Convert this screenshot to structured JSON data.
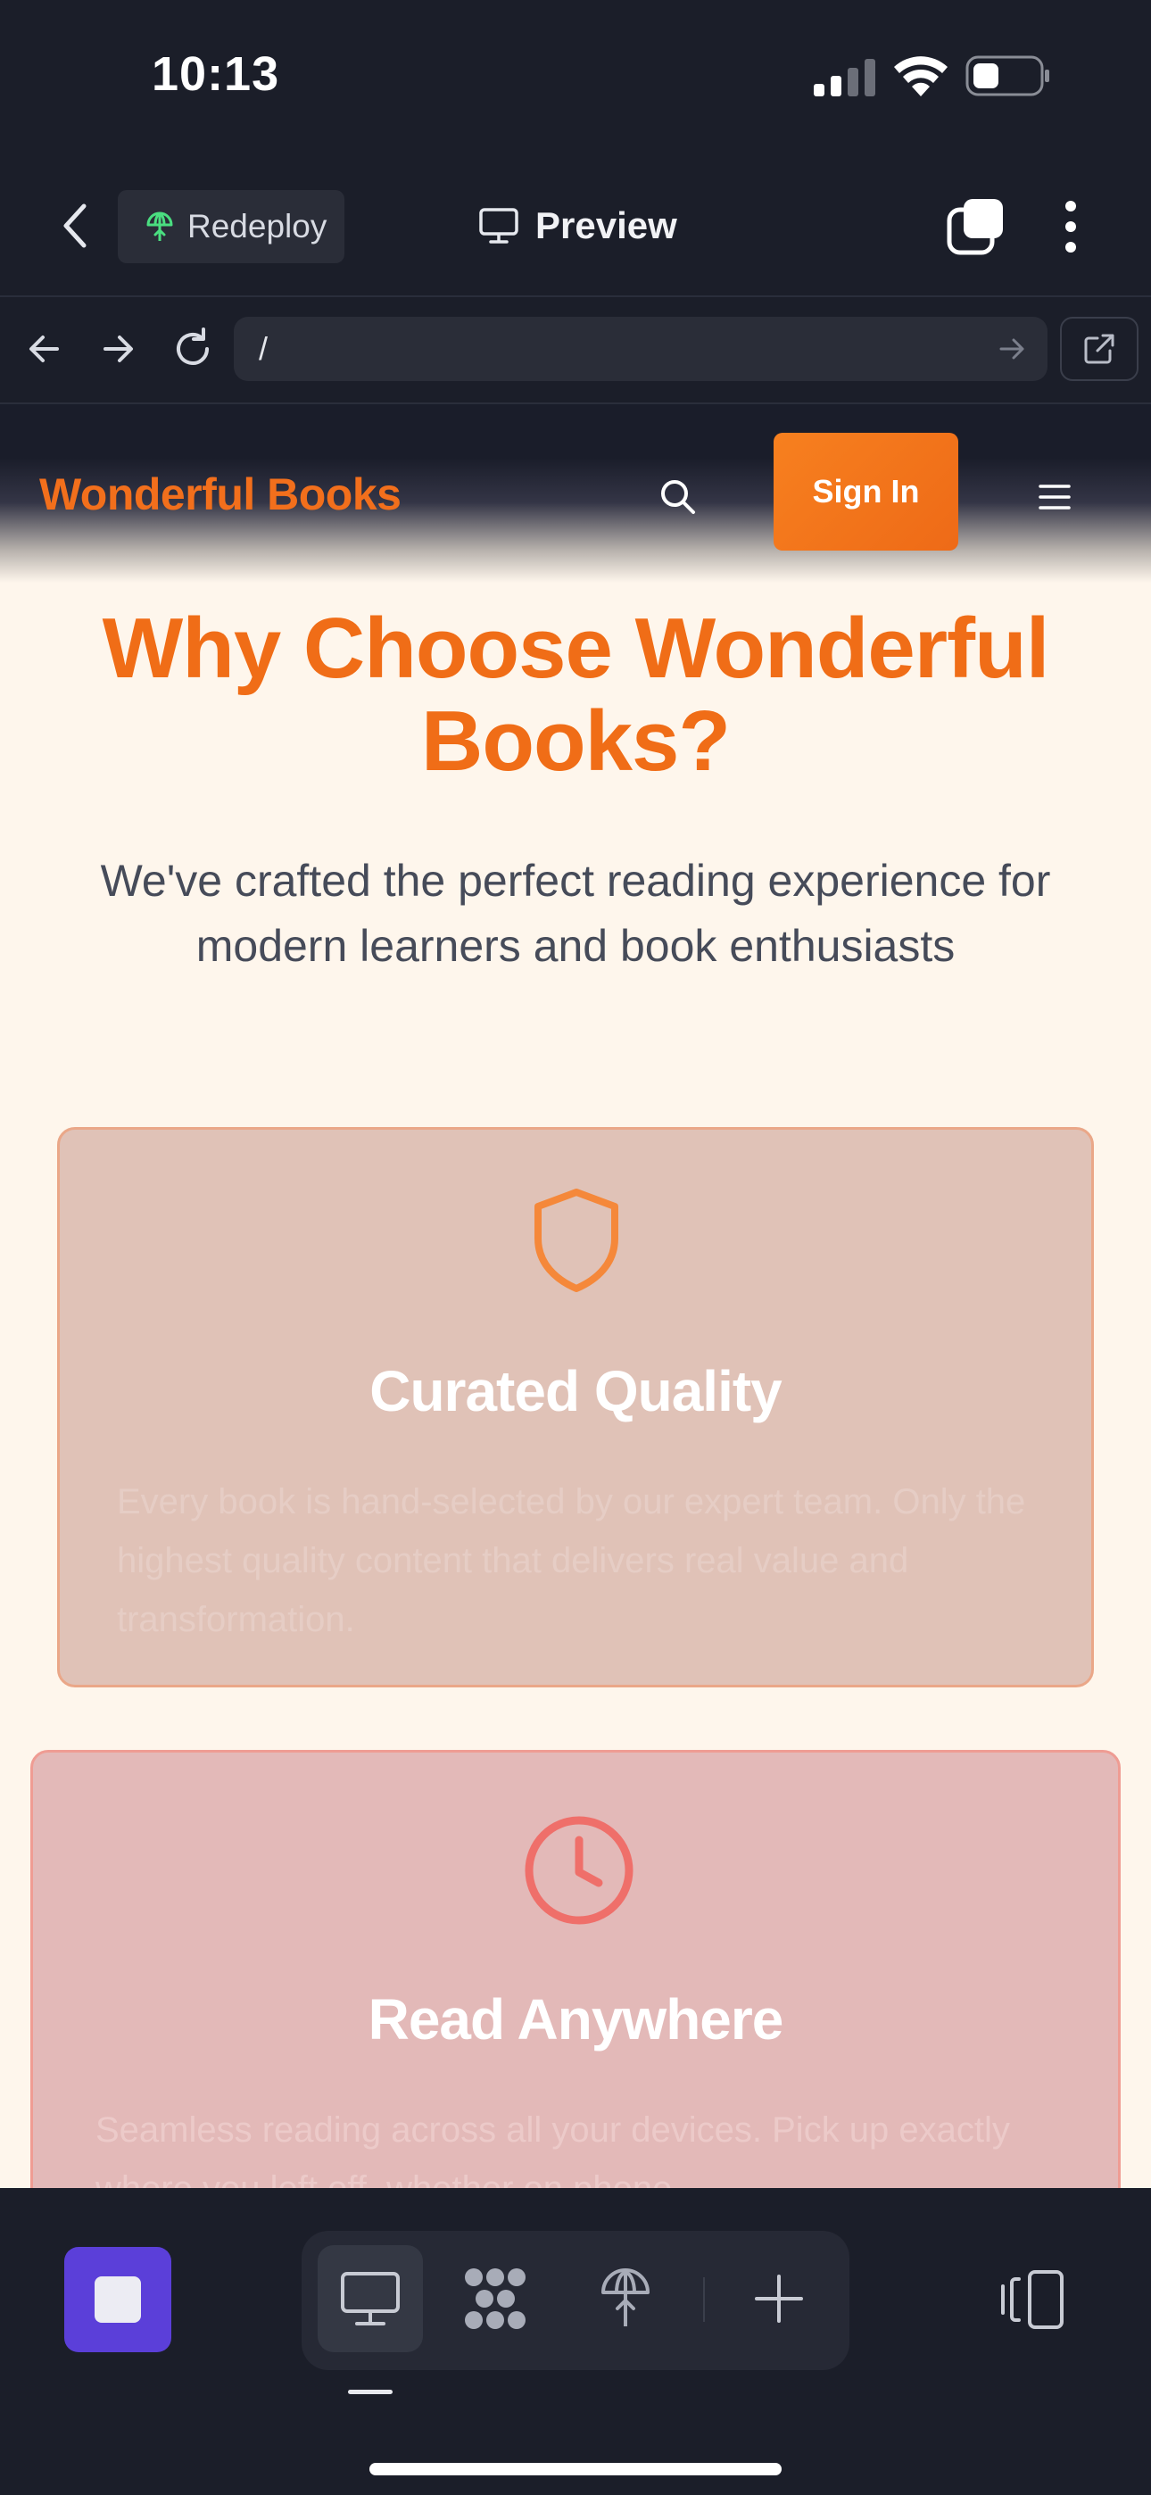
{
  "status_bar": {
    "time": "10:13"
  },
  "header": {
    "redeploy_label": "Redeploy",
    "preview_label": "Preview"
  },
  "browser": {
    "url": "/"
  },
  "site": {
    "logo": "Wonderful Books",
    "sign_in": "Sign In",
    "heading": "Why Choose Wonderful Books?",
    "subheading": "We've crafted the perfect reading experience for modern learners and book enthusiasts",
    "features": [
      {
        "icon": "shield-icon",
        "title": "Curated Quality",
        "description": "Every book is hand-selected by our expert team. Only the highest quality content that delivers real value and transformation."
      },
      {
        "icon": "clock-icon",
        "title": "Read Anywhere",
        "description": "Seamless reading across all your devices. Pick up exactly where you left off, whether on phone"
      }
    ]
  },
  "toolbar": {
    "modes": [
      "desktop-icon",
      "grid-icon",
      "deploy-icon",
      "plus-icon"
    ],
    "active_mode": "desktop-icon"
  },
  "colors": {
    "accent": "#f06d17",
    "app_bg": "#1b1e29",
    "page_bg": "#fef6ec",
    "stop_button": "#5b3fd9"
  }
}
